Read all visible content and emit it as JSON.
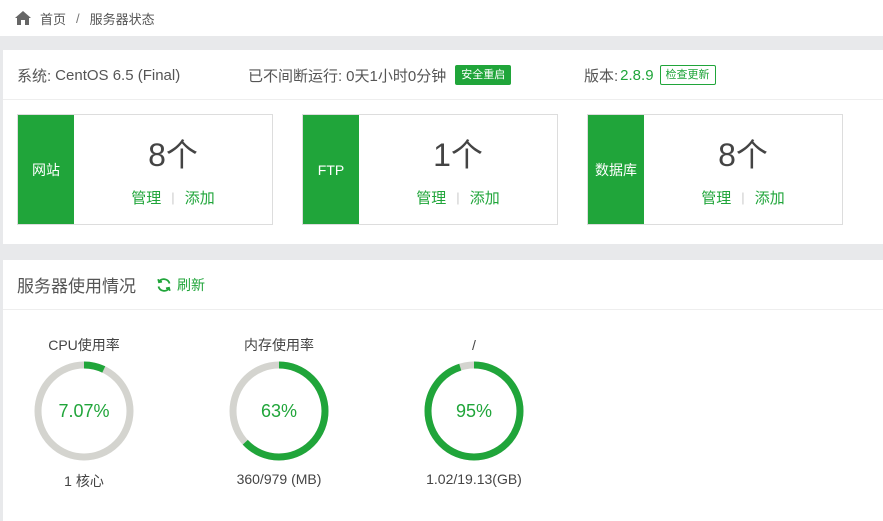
{
  "breadcrumb": {
    "home": "首页",
    "separator": "/",
    "current": "服务器状态"
  },
  "system": {
    "os_label": "系统:",
    "os_value": "CentOS 6.5 (Final)",
    "uptime_label": "已不间断运行:",
    "uptime_value": "0天1小时0分钟",
    "restart_button": "安全重启",
    "version_label": "版本:",
    "version_value": "2.8.9",
    "update_button": "检查更新"
  },
  "cards": [
    {
      "name": "网站",
      "count": "8个",
      "manage": "管理",
      "add": "添加"
    },
    {
      "name": "FTP",
      "count": "1个",
      "manage": "管理",
      "add": "添加"
    },
    {
      "name": "数据库",
      "count": "8个",
      "manage": "管理",
      "add": "添加"
    }
  ],
  "usage": {
    "title": "服务器使用情况",
    "refresh": "刷新",
    "gauges": [
      {
        "title": "CPU使用率",
        "percent_text": "7.07%",
        "value": 7.07,
        "sub": "1 核心"
      },
      {
        "title": "内存使用率",
        "percent_text": "63%",
        "value": 63,
        "sub": "360/979 (MB)"
      },
      {
        "title": "/",
        "percent_text": "95%",
        "value": 95,
        "sub": "1.02/19.13(GB)"
      }
    ]
  },
  "colors": {
    "accent": "#20a53a",
    "track": "#d4d4cf"
  }
}
